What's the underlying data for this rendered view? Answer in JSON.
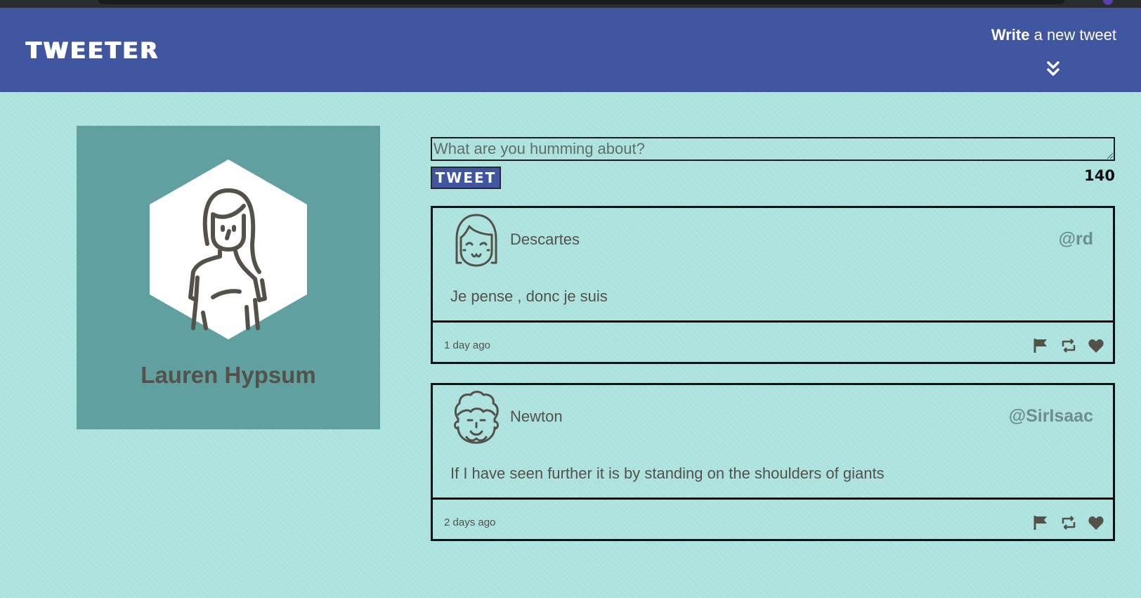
{
  "app": {
    "logo": "TWEETER"
  },
  "nav": {
    "compose_strong": "Write",
    "compose_rest": " a new tweet",
    "toggle_icon": "double-chevron-down-icon"
  },
  "profile": {
    "name": "Lauren Hypsum",
    "avatar_icon": "woman-avatar-icon"
  },
  "composer": {
    "placeholder": "What are you humming about?",
    "value": "",
    "submit_label": "TWEET",
    "char_count": "140"
  },
  "tweets": [
    {
      "name": "Descartes",
      "handle": "@rd",
      "text": "Je pense , donc je suis",
      "time": "1 day ago",
      "avatar_icon": "bangs-face-avatar-icon"
    },
    {
      "name": "Newton",
      "handle": "@SirIsaac",
      "text": "If I have seen further it is by standing on the shoulders of giants",
      "time": "2 days ago",
      "avatar_icon": "curly-hair-face-avatar-icon"
    }
  ],
  "actions": [
    "flag-icon",
    "retweet-icon",
    "heart-icon"
  ],
  "colors": {
    "nav_bg": "#4056a1",
    "page_bg": "#ade3df",
    "profile_bg": "#61a0a0",
    "text": "#545149",
    "handle": "#6d8d8f"
  }
}
